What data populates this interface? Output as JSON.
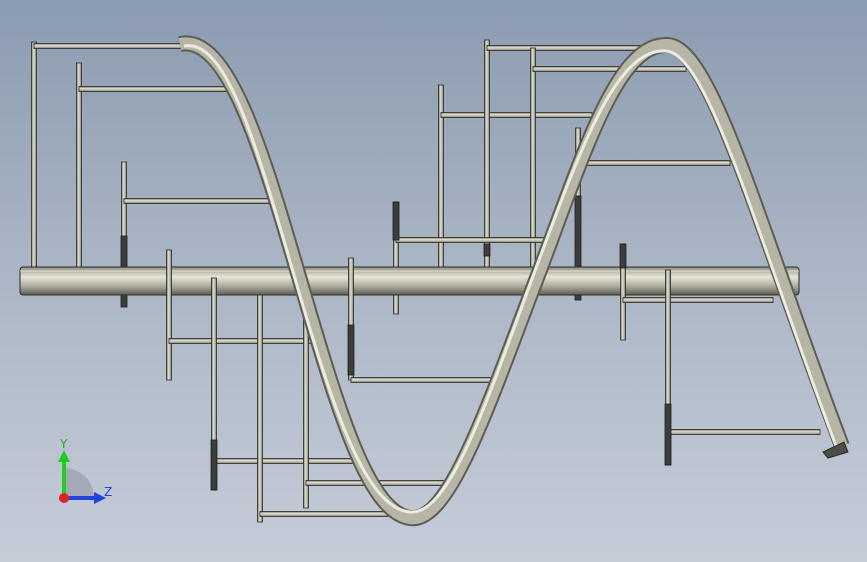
{
  "viewport": {
    "name": "3D model view",
    "background_top": "#8b9bb0",
    "background_bottom": "#c5ccd8"
  },
  "colors": {
    "metal_light": "#e4e3d6",
    "metal_mid": "#b7b6a6",
    "metal_dark": "#5d5d55",
    "outline": "#2b2b28",
    "sleeve": "#3c3c3c"
  },
  "triad": {
    "y_label": "Y",
    "z_label": "Z",
    "y_color": "#22cc22",
    "z_color": "#2244dd",
    "origin_color": "#e02020"
  }
}
